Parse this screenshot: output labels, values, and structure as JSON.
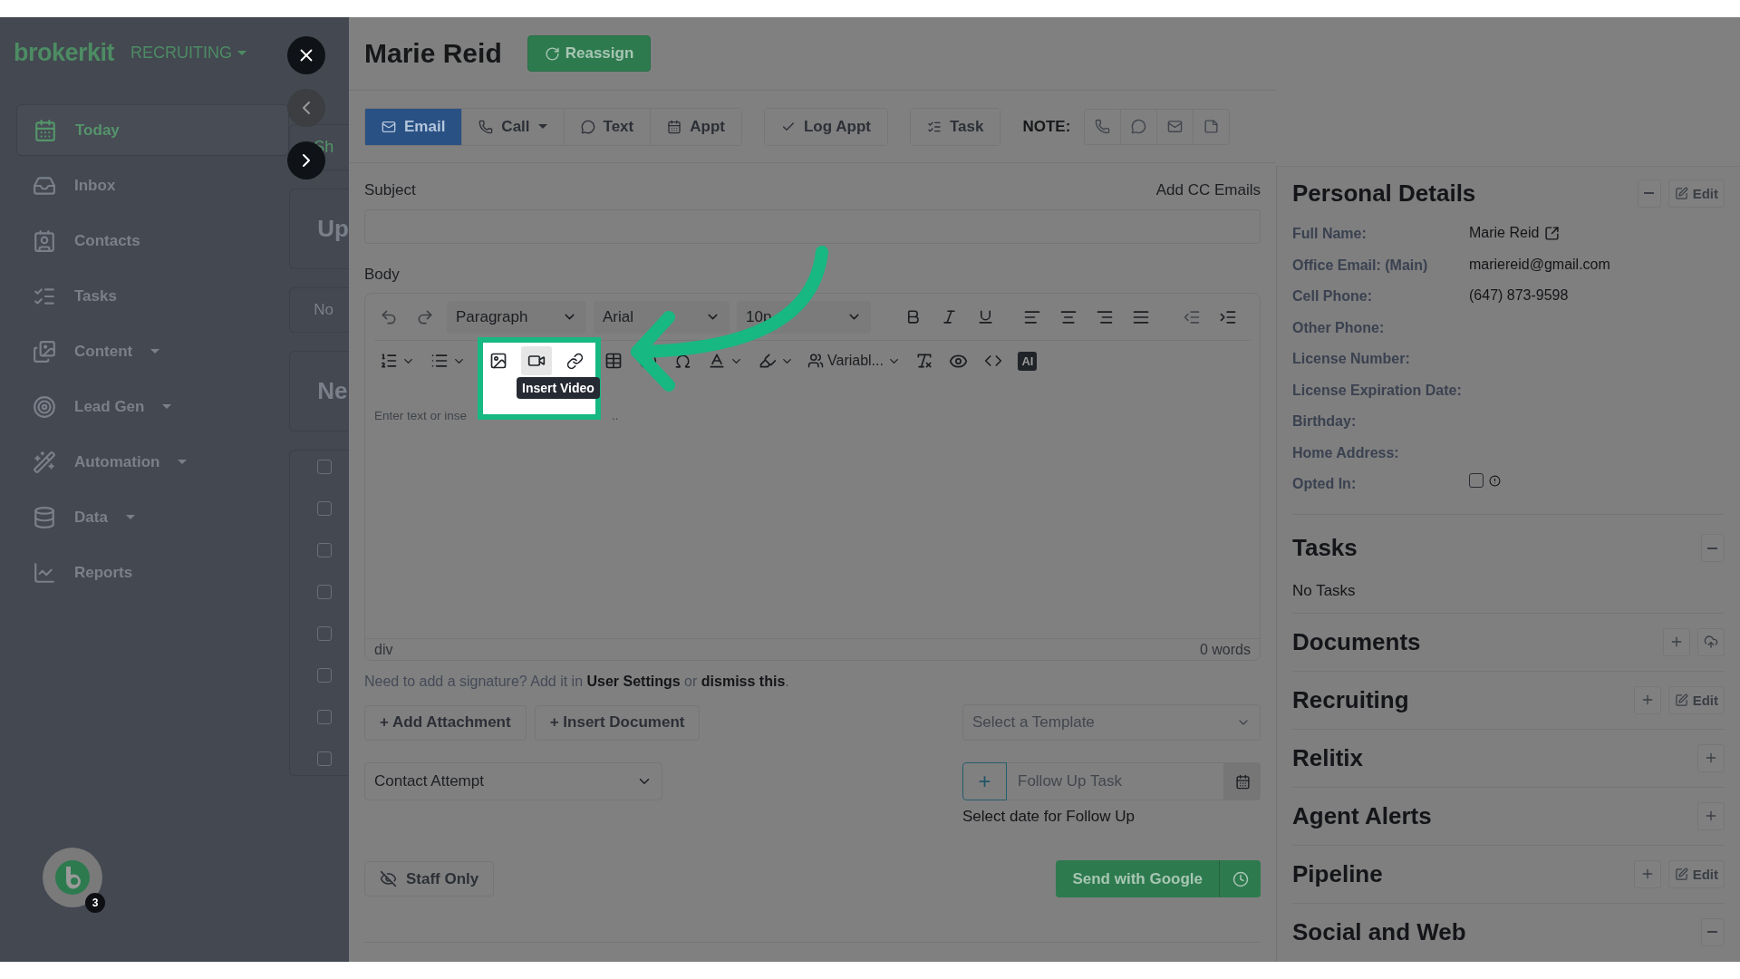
{
  "app": {
    "logo": "brokerkit",
    "workspace": "RECRUITING"
  },
  "sidebar": {
    "items": [
      {
        "label": "Today",
        "selected": true,
        "has_menu": false
      },
      {
        "label": "Inbox",
        "selected": false,
        "has_menu": false
      },
      {
        "label": "Contacts",
        "selected": false,
        "has_menu": false
      },
      {
        "label": "Tasks",
        "selected": false,
        "has_menu": false
      },
      {
        "label": "Content",
        "selected": false,
        "has_menu": true
      },
      {
        "label": "Lead Gen",
        "selected": false,
        "has_menu": true
      },
      {
        "label": "Automation",
        "selected": false,
        "has_menu": true
      },
      {
        "label": "Data",
        "selected": false,
        "has_menu": true
      },
      {
        "label": "Reports",
        "selected": false,
        "has_menu": false
      }
    ]
  },
  "background_page": {
    "fragments": [
      {
        "kind": "link",
        "text": "Sh"
      },
      {
        "kind": "heading",
        "text": "Up"
      },
      {
        "kind": "text",
        "text": "No"
      },
      {
        "kind": "heading",
        "text": "Ne"
      }
    ],
    "checkboxes": [
      {
        "checked": false
      },
      {
        "checked": false
      },
      {
        "checked": false
      },
      {
        "checked": false
      },
      {
        "checked": false
      },
      {
        "checked": false
      },
      {
        "checked": false
      },
      {
        "checked": false
      }
    ]
  },
  "chat": {
    "badge": "3"
  },
  "contact": {
    "name": "Marie Reid",
    "reassign": "Reassign"
  },
  "actions": {
    "tabs": [
      {
        "label": "Email",
        "selected": true,
        "has_menu": false
      },
      {
        "label": "Call",
        "selected": false,
        "has_menu": true
      },
      {
        "label": "Text",
        "selected": false,
        "has_menu": false
      },
      {
        "label": "Appt",
        "selected": false,
        "has_menu": false
      }
    ],
    "log_appt": "Log Appt",
    "task": "Task",
    "note_label": "NOTE:"
  },
  "email": {
    "subject_label": "Subject",
    "add_cc": "Add CC Emails",
    "body_label": "Body",
    "toolbar": {
      "block_format": "Paragraph",
      "font": "Arial",
      "size": "10p",
      "variables": "Variabl...",
      "ai": "AI",
      "insert_buttons": [
        {
          "kind": "image",
          "hovered": false
        },
        {
          "kind": "video",
          "hovered": true
        },
        {
          "kind": "link",
          "hovered": false
        }
      ],
      "tooltip": "Insert Video"
    },
    "placeholder_start": "Enter text or inse",
    "placeholder_end": "..",
    "status_path": "div",
    "word_count": "0 words",
    "signature": {
      "prefix": "Need to add a signature? Add it in",
      "link": "User Settings",
      "middle": "or",
      "dismiss": "dismiss this",
      "suffix": "."
    },
    "add_attachment": "+ Add Attachment",
    "insert_document": "+ Insert Document",
    "template_placeholder": "Select a Template",
    "outcome": "Contact Attempt",
    "follow_up_add": "+",
    "follow_up_placeholder": "Follow Up Task",
    "follow_up_hint": "Select date for Follow Up",
    "staff_only": "Staff Only",
    "send": "Send with Google"
  },
  "personal_details": {
    "title": "Personal Details",
    "edit": "Edit",
    "fields": [
      {
        "label": "Full Name:",
        "value": "Marie Reid",
        "kind": "link"
      },
      {
        "label": "Office Email: (Main)",
        "value": "mariereid@gmail.com",
        "kind": "text"
      },
      {
        "label": "Cell Phone:",
        "value": "(647) 873-9598",
        "kind": "text"
      },
      {
        "label": "Other Phone:",
        "kind": "text"
      },
      {
        "label": "License Number:",
        "kind": "text"
      },
      {
        "label": "License Expiration Date:",
        "kind": "text"
      },
      {
        "label": "Birthday:",
        "kind": "text"
      },
      {
        "label": "Home Address:",
        "kind": "text"
      },
      {
        "label": "Opted In:",
        "kind": "checkbox",
        "checked": false
      }
    ]
  },
  "sections": [
    {
      "title": "Tasks",
      "body": "No Tasks",
      "controls": [
        {
          "kind": "collapse"
        }
      ]
    },
    {
      "title": "Documents",
      "controls": [
        {
          "kind": "add"
        },
        {
          "kind": "upload"
        }
      ]
    },
    {
      "title": "Recruiting",
      "controls": [
        {
          "kind": "add"
        },
        {
          "kind": "edit",
          "label": "Edit"
        }
      ]
    },
    {
      "title": "Relitix",
      "controls": [
        {
          "kind": "add"
        }
      ]
    },
    {
      "title": "Agent Alerts",
      "controls": [
        {
          "kind": "add"
        }
      ]
    },
    {
      "title": "Pipeline",
      "controls": [
        {
          "kind": "add"
        },
        {
          "kind": "edit",
          "label": "Edit"
        }
      ]
    },
    {
      "title": "Social and Web",
      "controls": [
        {
          "kind": "collapse"
        }
      ]
    }
  ]
}
